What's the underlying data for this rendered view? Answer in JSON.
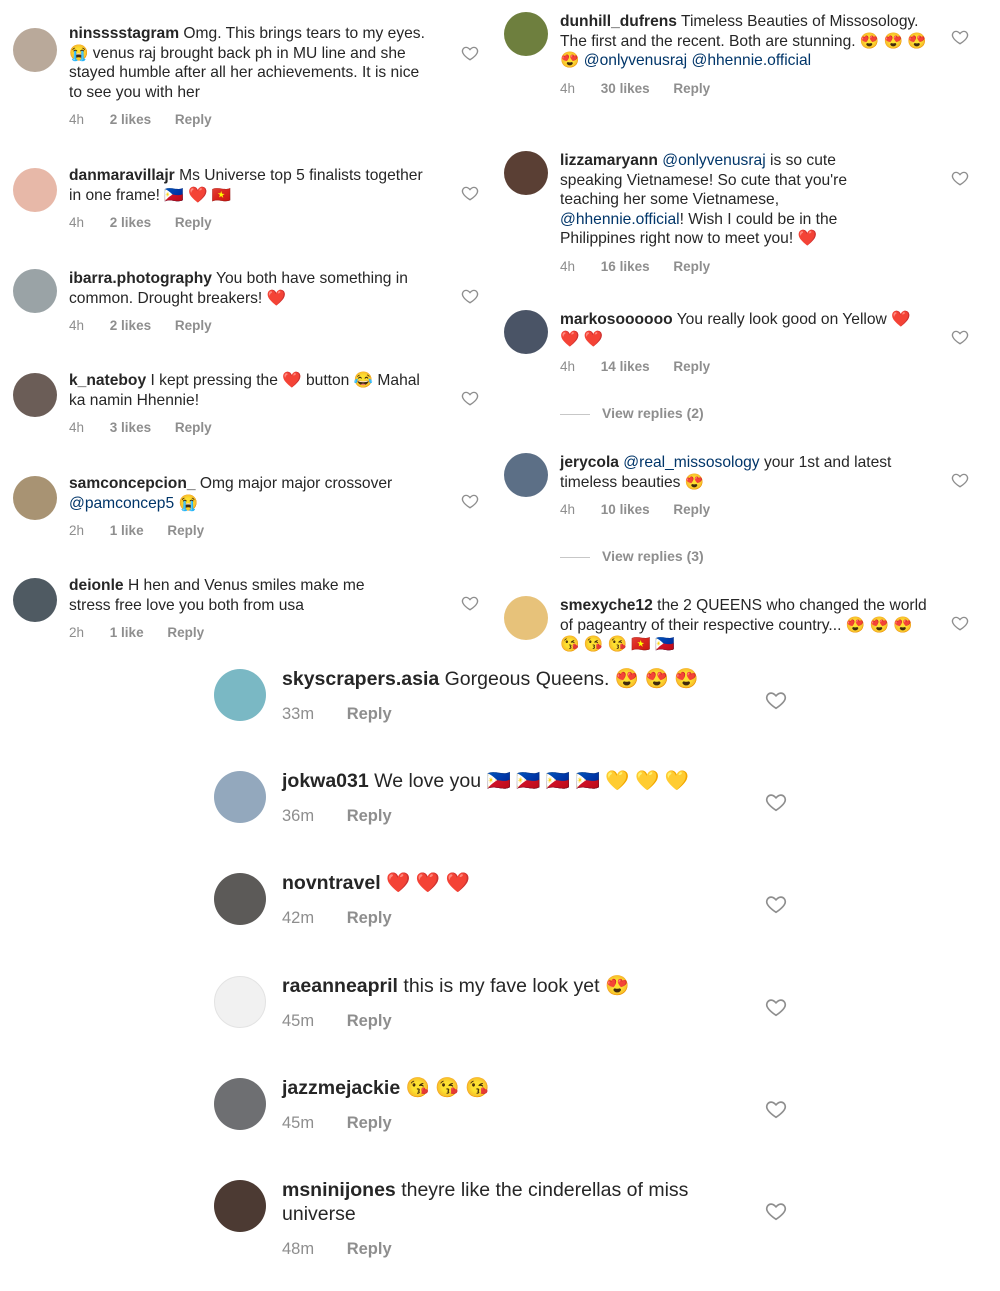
{
  "left_comments": [
    {
      "username": "ninsssstagram",
      "text": "Omg. This brings tears to my eyes.😭 venus raj brought back ph in MU line and she stayed humble after all her achievements. It is nice to see you with her",
      "time": "4h",
      "likes": "2 likes",
      "reply": "Reply",
      "avatar_color": "#b9a99a"
    },
    {
      "username": "danmaravillajr",
      "text": "Ms Universe top 5 finalists together in one frame! 🇵🇭 ❤️ 🇻🇳",
      "time": "4h",
      "likes": "2 likes",
      "reply": "Reply",
      "avatar_color": "#e7b8a8"
    },
    {
      "username": "ibarra.photography",
      "text": "You both have something in common.  Drought breakers! ❤️",
      "time": "4h",
      "likes": "2 likes",
      "reply": "Reply",
      "avatar_color": "#9aa3a6"
    },
    {
      "username": "k_nateboy",
      "text": "I kept pressing the ❤️ button 😂 Mahal ka namin Hhennie!",
      "time": "4h",
      "likes": "3 likes",
      "reply": "Reply",
      "avatar_color": "#6b5d57"
    },
    {
      "username": "samconcepcion_",
      "text": "Omg major major crossover",
      "mention": "@pamconcep5",
      "suffix": " 😭",
      "time": "2h",
      "likes": "1 like",
      "reply": "Reply",
      "avatar_color": "#a89373"
    },
    {
      "username": "deionle",
      "text": "H hen and Venus smiles make me stress free love you both from usa",
      "time": "2h",
      "likes": "1 like",
      "reply": "Reply",
      "avatar_color": "#4f5a62"
    }
  ],
  "right_comments": [
    {
      "username": "dunhill_dufrens",
      "text": "Timeless Beauties of Missosology. The first and the recent. Both are stunning. 😍 😍 😍 😍",
      "mention": "@onlyvenusraj",
      "mention2": "@hhennie.official",
      "time": "4h",
      "likes": "30 likes",
      "reply": "Reply",
      "avatar_color": "#6e7f3e"
    },
    {
      "username": "lizzamaryann",
      "mention": "@onlyvenusraj",
      "text": "is so cute speaking Vietnamese!  So cute that you're teaching her some Vietnamese,",
      "mention2": "@hhennie.official",
      "text2": "!  Wish I could be in the Philippines right now to meet you! ❤️",
      "time": "4h",
      "likes": "16 likes",
      "reply": "Reply",
      "avatar_color": "#5a3f34"
    },
    {
      "username": "markosoooooo",
      "text": "You really look good on Yellow ❤️ ❤️ ❤️",
      "time": "4h",
      "likes": "14 likes",
      "reply": "Reply",
      "view_replies": "View replies (2)",
      "avatar_color": "#4a5466"
    },
    {
      "username": "jerycola",
      "mention": "@real_missosology",
      "text": "your 1st and latest timeless beauties 😍",
      "time": "4h",
      "likes": "10 likes",
      "reply": "Reply",
      "view_replies": "View replies (3)",
      "avatar_color": "#5c6f86"
    },
    {
      "username": "smexyche12",
      "text": "the 2 QUEENS who changed the world of pageantry of their respective country... 😍 😍 😍 😘 😘 😘 🇻🇳 🇵🇭",
      "avatar_color": "#e7c27a"
    }
  ],
  "bottom_comments": [
    {
      "username": "skyscrapers.asia",
      "text": "Gorgeous Queens. 😍 😍 😍",
      "time": "33m",
      "reply": "Reply",
      "avatar_color": "#7ab8c4"
    },
    {
      "username": "jokwa031",
      "text": "We love you 🇵🇭 🇵🇭 🇵🇭 🇵🇭 💛 💛 💛",
      "time": "36m",
      "reply": "Reply",
      "avatar_color": "#93a8bd"
    },
    {
      "username": "novntravel",
      "text": "❤️ ❤️ ❤️",
      "time": "42m",
      "reply": "Reply",
      "avatar_color": "#5c5a58"
    },
    {
      "username": "raeanneapril",
      "text": "this is my fave look yet 😍",
      "time": "45m",
      "reply": "Reply",
      "avatar_color": "#f1f1f1"
    },
    {
      "username": "jazzmejackie",
      "text": "😘 😘 😘",
      "time": "45m",
      "reply": "Reply",
      "avatar_color": "#6e6f72"
    },
    {
      "username": "msninijones",
      "text": "theyre like the cinderellas of miss universe",
      "time": "48m",
      "reply": "Reply",
      "avatar_color": "#4c3a33"
    }
  ],
  "icons": {
    "like": "heart-outline-icon"
  },
  "colors": {
    "text": "#262626",
    "meta": "#8e8e8e",
    "mention": "#003569"
  }
}
